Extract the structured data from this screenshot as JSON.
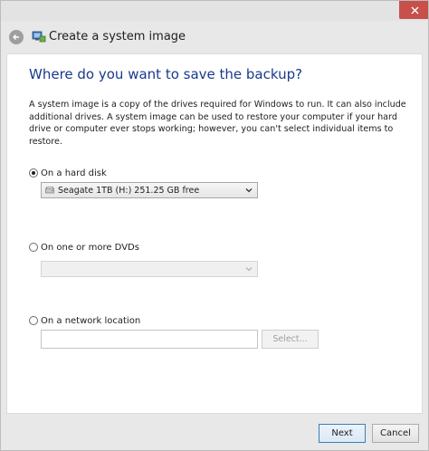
{
  "window": {
    "title": "Create a system image"
  },
  "main": {
    "heading": "Where do you want to save the backup?",
    "description": "A system image is a copy of the drives required for Windows to run. It can also include additional drives. A system image can be used to restore your computer if your hard drive or computer ever stops working; however, you can't select individual items to restore."
  },
  "options": {
    "hard_disk": {
      "label": "On a hard disk",
      "selected": true,
      "drive_value": "Seagate 1TB (H:)  251.25 GB free"
    },
    "dvd": {
      "label": "On one or more DVDs",
      "selected": false,
      "drive_value": ""
    },
    "network": {
      "label": "On a network location",
      "selected": false,
      "location_value": "",
      "browse_label": "Select..."
    }
  },
  "footer": {
    "next_label": "Next",
    "cancel_label": "Cancel"
  },
  "colors": {
    "heading": "#1a3a8c",
    "close_button": "#c7504b",
    "primary_border": "#3c7fb1"
  },
  "icons": {
    "close": "close-icon",
    "back": "back-arrow-icon",
    "wizard": "backup-wizard-icon",
    "drive": "hard-drive-icon",
    "dropdown": "chevron-down-icon"
  }
}
